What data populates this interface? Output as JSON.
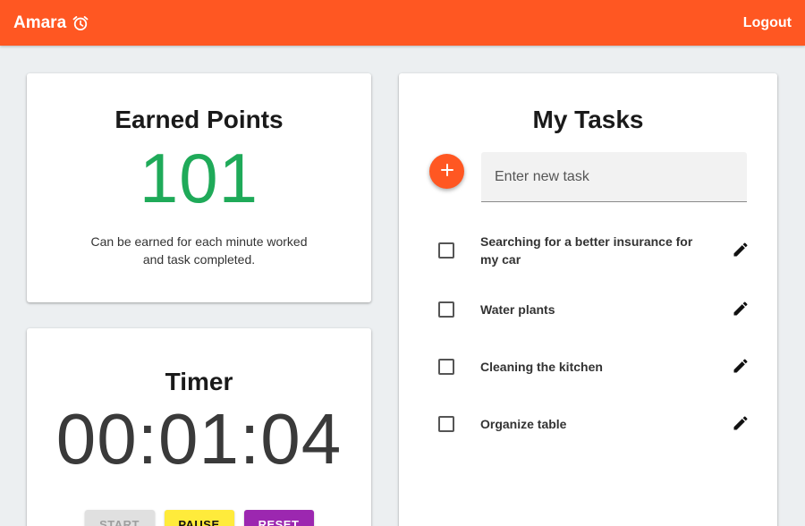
{
  "app": {
    "title": "Amara",
    "brand_icon": "alarm-clock-icon",
    "logout_label": "Logout",
    "accent": "#ff5722"
  },
  "points": {
    "title": "Earned Points",
    "value": "101",
    "description": "Can be earned for each minute worked and task completed.",
    "color": "#1faa59"
  },
  "timer": {
    "title": "Timer",
    "value": "00:01:04",
    "start_label": "START",
    "pause_label": "PAUSE",
    "reset_label": "RESET"
  },
  "tasks": {
    "title": "My Tasks",
    "input_placeholder": "Enter new task",
    "items": [
      {
        "label": "Searching for a better insurance for my car",
        "checked": false
      },
      {
        "label": "Water plants",
        "checked": false
      },
      {
        "label": "Cleaning the kitchen",
        "checked": false
      },
      {
        "label": "Organize table",
        "checked": false
      }
    ]
  }
}
